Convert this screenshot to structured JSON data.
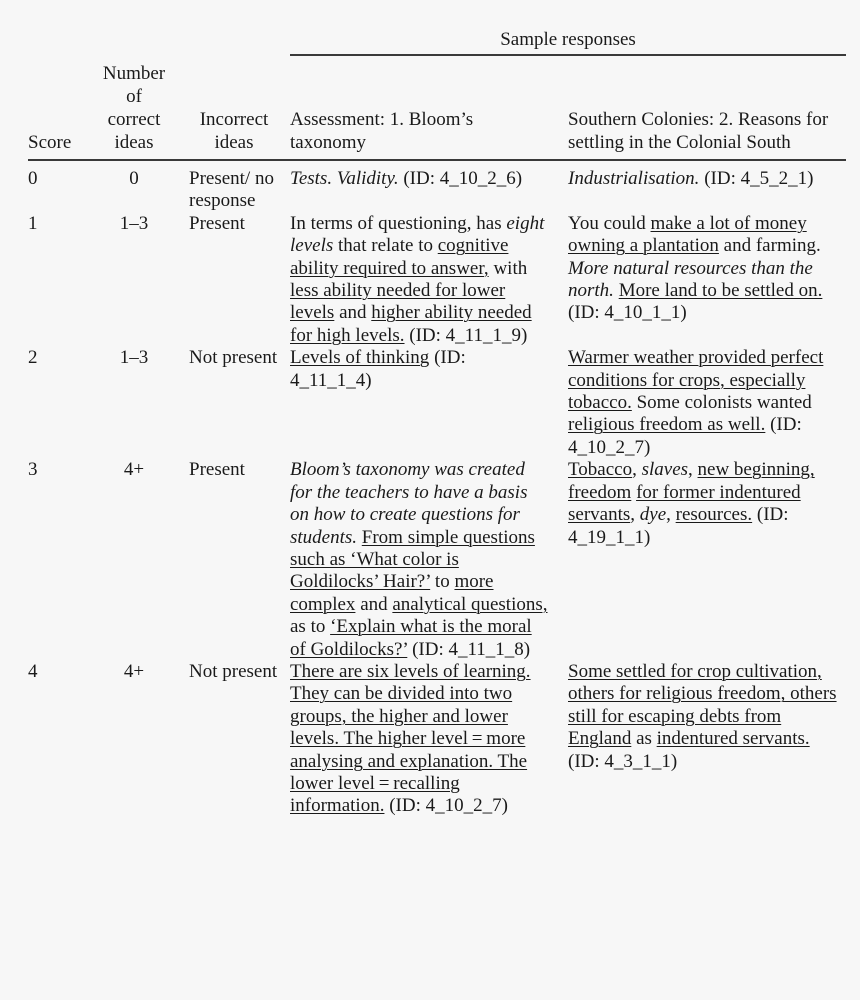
{
  "table": {
    "spanner": "Sample responses",
    "columns": {
      "score": "Score",
      "correct_ideas": "Number of correct ideas",
      "correct_ideas_lines": [
        "Number",
        "of",
        "correct",
        "ideas"
      ],
      "incorrect_ideas": "Incorrect ideas",
      "incorrect_ideas_lines": [
        "Incorrect",
        "ideas"
      ],
      "assessment": "Assessment: 1. Bloom’s taxonomy",
      "southern": "Southern Colonies: 2. Reasons for settling in the Colonial South"
    },
    "rows": [
      {
        "score": "0",
        "correct_ideas": "0",
        "incorrect_ideas": "Present/ no response",
        "assessment_text": "Tests. Validity. (ID: 4_10_2_6)",
        "assessment_id": "4_10_2_6",
        "southern_text": "Industrialisation. (ID: 4_5_2_1)",
        "southern_id": "4_5_2_1"
      },
      {
        "score": "1",
        "correct_ideas": "1–3",
        "incorrect_ideas": "Present",
        "assessment_text": "In terms of questioning, has eight levels that relate to cognitive ability required to answer, with less ability needed for lower levels and higher ability needed for high levels. (ID: 4_11_1_9)",
        "assessment_id": "4_11_1_9",
        "southern_text": "You could make a lot of money owning a plantation and farming. More natural resources than the north. More land to be settled on. (ID: 4_10_1_1)",
        "southern_id": "4_10_1_1"
      },
      {
        "score": "2",
        "correct_ideas": "1–3",
        "incorrect_ideas": "Not present",
        "assessment_text": "Levels of thinking (ID: 4_11_1_4)",
        "assessment_id": "4_11_1_4",
        "southern_text": "Warmer weather provided perfect conditions for crops, especially tobacco. Some colonists wanted religious freedom as well. (ID: 4_10_2_7)",
        "southern_id": "4_10_2_7"
      },
      {
        "score": "3",
        "correct_ideas": "4+",
        "incorrect_ideas": "Present",
        "assessment_text": "Bloom’s taxonomy was created for the teachers to have a basis on how to create questions for students. From simple questions such as ‘What color is Goldilocks’ Hair?’ to more complex and analytical questions, as to ‘Explain what is the moral of Goldilocks?’ (ID: 4_11_1_8)",
        "assessment_id": "4_11_1_8",
        "southern_text": "Tobacco, slaves, new beginning, freedom for former indentured servants, dye, resources. (ID: 4_19_1_1)",
        "southern_id": "4_19_1_1"
      },
      {
        "score": "4",
        "correct_ideas": "4+",
        "incorrect_ideas": "Not present",
        "assessment_text": "There are six levels of learning. They can be divided into two groups, the higher and lower levels. The higher level = more analysing and explanation. The lower level = recalling information. (ID: 4_10_2_7)",
        "assessment_id": "4_10_2_7",
        "southern_text": "Some settled for crop cultivation, others for religious freedom, others still for escaping debts from England as indentured servants. (ID: 4_3_1_1)",
        "southern_id": "4_3_1_1"
      }
    ]
  },
  "rich": {
    "r0_assess": [
      {
        "t": "Tests. Validity.",
        "s": "italic"
      },
      {
        "t": " (ID: 4_10_2_6)",
        "s": "plain"
      }
    ],
    "r0_south": [
      {
        "t": "Industrialisation.",
        "s": "italic"
      },
      {
        "t": " (ID: 4_5_2_1)",
        "s": "plain"
      }
    ],
    "r1_assess": [
      {
        "t": "In terms of questioning, has ",
        "s": "plain"
      },
      {
        "t": "eight levels",
        "s": "italic"
      },
      {
        "t": " that relate to ",
        "s": "plain"
      },
      {
        "t": "cognitive ability required to answer,",
        "s": "underline"
      },
      {
        "t": " with ",
        "s": "plain"
      },
      {
        "t": "less ability needed for lower levels",
        "s": "underline"
      },
      {
        "t": " and ",
        "s": "plain"
      },
      {
        "t": "higher ability needed for high levels.",
        "s": "underline"
      },
      {
        "t": " (ID: 4_11_1_9)",
        "s": "plain"
      }
    ],
    "r1_south": [
      {
        "t": "You could ",
        "s": "plain"
      },
      {
        "t": "make a lot of money owning a plantation",
        "s": "underline"
      },
      {
        "t": " and farming. ",
        "s": "plain"
      },
      {
        "t": "More natural resources than the north.",
        "s": "italic"
      },
      {
        "t": " ",
        "s": "plain"
      },
      {
        "t": "More land to be settled on.",
        "s": "underline"
      },
      {
        "t": " (ID: 4_10_1_1)",
        "s": "plain"
      }
    ],
    "r2_assess": [
      {
        "t": "Levels of thinking",
        "s": "underline"
      },
      {
        "t": " (ID: 4_11_1_4)",
        "s": "plain"
      }
    ],
    "r2_south": [
      {
        "t": "Warmer weather provided perfect conditions for crops, especially tobacco.",
        "s": "underline"
      },
      {
        "t": " Some colonists wanted ",
        "s": "plain"
      },
      {
        "t": "religious freedom as well.",
        "s": "underline"
      },
      {
        "t": " (ID: 4_10_2_7)",
        "s": "plain"
      }
    ],
    "r3_assess": [
      {
        "t": "Bloom’s taxonomy was created for the teachers to have a basis on how to create questions for students.",
        "s": "italic"
      },
      {
        "t": " ",
        "s": "plain"
      },
      {
        "t": "From simple questions such as ‘What color is Goldilocks’ Hair?’",
        "s": "underline"
      },
      {
        "t": " to ",
        "s": "plain"
      },
      {
        "t": "more complex",
        "s": "underline"
      },
      {
        "t": " and ",
        "s": "plain"
      },
      {
        "t": "analytical questions,",
        "s": "underline"
      },
      {
        "t": " as to ",
        "s": "plain"
      },
      {
        "t": "‘Explain what is the moral of Goldilocks?’",
        "s": "underline"
      },
      {
        "t": " (ID: 4_11_1_8)",
        "s": "plain"
      }
    ],
    "r3_south": [
      {
        "t": "Tobacco",
        "s": "underline"
      },
      {
        "t": ", ",
        "s": "plain"
      },
      {
        "t": "slaves",
        "s": "italic"
      },
      {
        "t": ", ",
        "s": "plain"
      },
      {
        "t": "new beginning,",
        "s": "underline"
      },
      {
        "t": " ",
        "s": "plain"
      },
      {
        "t": "freedom",
        "s": "underline"
      },
      {
        "t": " ",
        "s": "plain"
      },
      {
        "t": "for former indentured servants",
        "s": "underline"
      },
      {
        "t": ", ",
        "s": "plain"
      },
      {
        "t": "dye",
        "s": "italic"
      },
      {
        "t": ", ",
        "s": "plain"
      },
      {
        "t": "resources.",
        "s": "underline"
      },
      {
        "t": " (ID: 4_19_1_1)",
        "s": "plain"
      }
    ],
    "r4_assess": [
      {
        "t": "There are six levels of learning. They can be divided into two groups, the higher and lower levels. The higher level = more analysing and explanation. The lower level = recalling information.",
        "s": "underline"
      },
      {
        "t": " (ID: 4_10_2_7)",
        "s": "plain"
      }
    ],
    "r4_south": [
      {
        "t": "Some settled for crop cultivation, others for religious freedom, others still for escaping debts from England",
        "s": "underline"
      },
      {
        "t": " as ",
        "s": "plain"
      },
      {
        "t": "indentured servants.",
        "s": "underline"
      },
      {
        "t": " (ID: 4_3_1_1)",
        "s": "plain"
      }
    ]
  }
}
